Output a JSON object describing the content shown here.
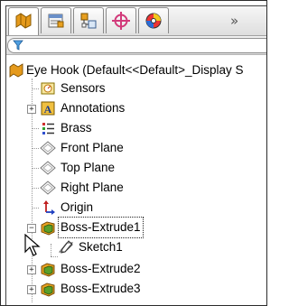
{
  "tabs": [
    {
      "name": "featuremanager-tab",
      "icon": "featuremanager-icon"
    },
    {
      "name": "propertymanager-tab",
      "icon": "propertymanager-icon"
    },
    {
      "name": "configurationmanager-tab",
      "icon": "configurationmanager-icon"
    },
    {
      "name": "dimxpert-tab",
      "icon": "dimxpert-icon"
    },
    {
      "name": "displaymanager-tab",
      "icon": "displaymanager-icon"
    }
  ],
  "more_label": "»",
  "tree": {
    "root": "Eye Hook  (Default<<Default>_Display S",
    "items": [
      {
        "label": "Sensors",
        "icon": "sensors-icon"
      },
      {
        "label": "Annotations",
        "icon": "annotations-icon"
      },
      {
        "label": "Brass",
        "icon": "material-icon"
      },
      {
        "label": "Front Plane",
        "icon": "plane-icon"
      },
      {
        "label": "Top Plane",
        "icon": "plane-icon"
      },
      {
        "label": "Right Plane",
        "icon": "plane-icon"
      },
      {
        "label": "Origin",
        "icon": "origin-icon"
      },
      {
        "label": "Boss-Extrude1",
        "icon": "extrude-icon"
      },
      {
        "label": "Sketch1",
        "icon": "sketch-icon"
      },
      {
        "label": "Boss-Extrude2",
        "icon": "extrude-icon"
      },
      {
        "label": "Boss-Extrude3",
        "icon": "extrude-icon"
      }
    ]
  },
  "colors": {
    "accent_orange": "#e8a020",
    "extrude_green": "#5aa02a",
    "selection": "#316ac5"
  }
}
